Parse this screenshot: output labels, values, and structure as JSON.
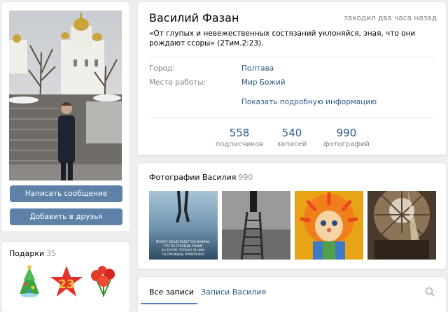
{
  "profile": {
    "name": "Василий Фазан",
    "last_seen": "заходил два часа назад",
    "status": "«От глупых и невежественных состязаний уклоняйся, зная, что они рождают ссоры» (2Тим.2:23).",
    "city_label": "Город:",
    "city_value": "Полтава",
    "work_label": "Место работы:",
    "work_value": "Мир Божий",
    "show_more": "Показать подробную информацию"
  },
  "counters": [
    {
      "num": "558",
      "label": "подписчиков"
    },
    {
      "num": "540",
      "label": "записей"
    },
    {
      "num": "990",
      "label": "фотографий"
    }
  ],
  "actions": {
    "message": "Написать сообщение",
    "add_friend": "Добавить в друзья"
  },
  "gifts": {
    "title": "Подарки",
    "count": "35"
  },
  "photos": {
    "title": "Фотографии Василия",
    "count": "990",
    "caption_text": "МОЖЕТ, ВЕЩИ БУДУТ ТАК ВАЖНЫ, ЧТО ТЫ СТАНЕШЬ ТАКИМ ЗА БОГОМ. ТОЛЬКО ЗА НИМ ТЫ СМОЖЕШЬ ПРОЙТИ ВСЁ."
  },
  "wall": {
    "tab_all": "Все записи",
    "tab_user": "Записи Василия"
  },
  "colors": {
    "accent": "#5181b8",
    "button": "#5e81a8",
    "link": "#2a5885",
    "muted": "#828282",
    "background": "#edeef0"
  },
  "icons": [
    "search-icon",
    "tree-gift-icon",
    "star-gift-icon",
    "flowers-gift-icon"
  ]
}
